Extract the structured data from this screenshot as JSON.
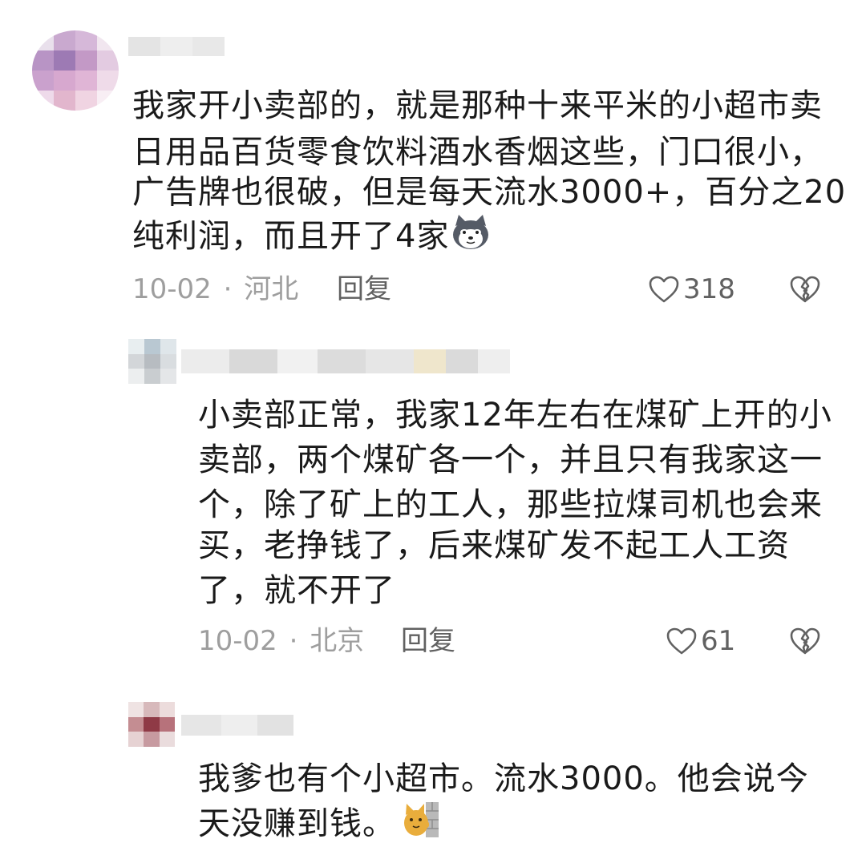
{
  "comments": [
    {
      "lines": [
        "我家开小卖部的，就是那种十来平米的小超市卖",
        "日用品百货零食饮料酒水香烟这些，门口很小，",
        "广告牌也很破，但是每天流水3000+，百分之20",
        "纯利润，而且开了4家"
      ],
      "date": "10-02",
      "sep": "·",
      "location": "河北",
      "reply_label": "回复",
      "likes": "318",
      "emoji_icon": "husky-dog-emoji-icon"
    },
    {
      "lines": [
        "小卖部正常，我家12年左右在煤矿上开的小",
        "卖部，两个煤矿各一个，并且只有我家这一",
        "个，除了矿上的工人，那些拉煤司机也会来",
        "买，老挣钱了，后来煤矿发不起工人工资",
        "了，就不开了"
      ],
      "date": "10-02",
      "sep": "·",
      "location": "北京",
      "reply_label": "回复",
      "likes": "61"
    },
    {
      "lines": [
        "我爹也有个小超市。流水3000。他会说今",
        "天没赚到钱。"
      ],
      "emoji_icon": "cat-behind-wall-emoji-icon"
    }
  ],
  "colors": {
    "meta_gray": "#9e9e9e",
    "action_gray": "#616161",
    "text": "#1a1a1a"
  }
}
